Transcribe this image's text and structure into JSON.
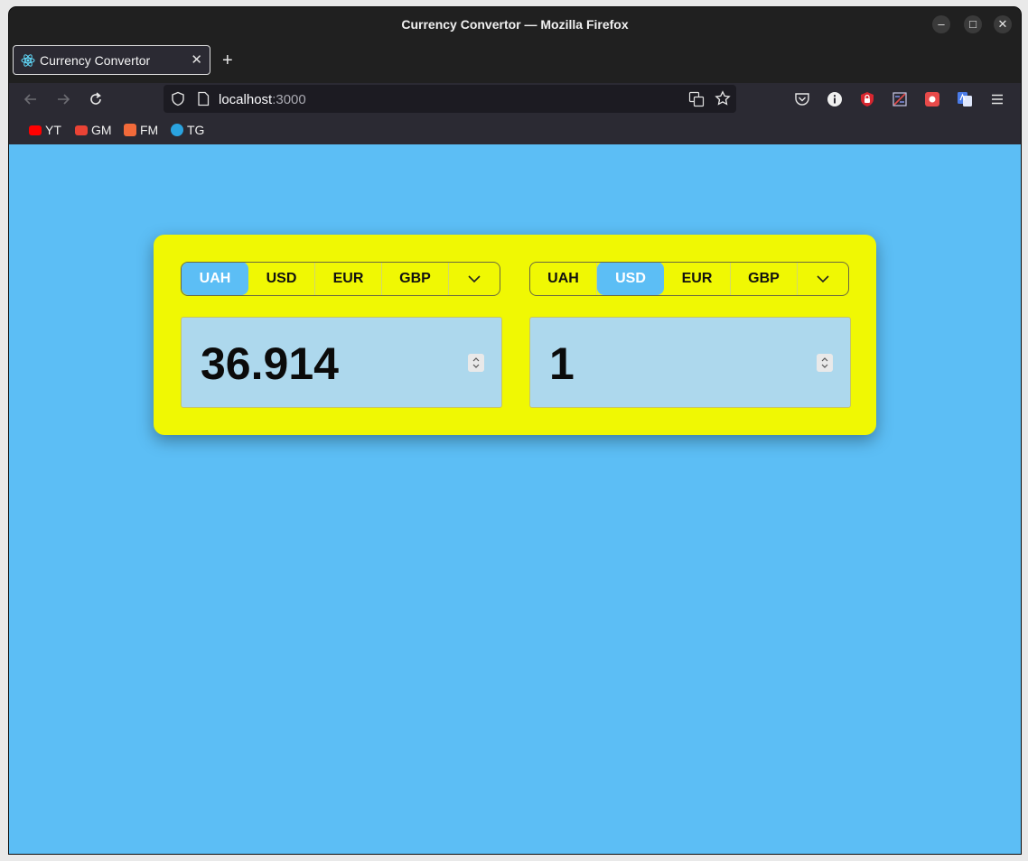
{
  "window": {
    "title": "Currency Convertor — Mozilla Firefox",
    "controls": {
      "minimize": "–",
      "maximize": "□",
      "close": "✕"
    }
  },
  "tab": {
    "title": "Currency Convertor",
    "close": "✕",
    "icon": "react-icon"
  },
  "new_tab": "+",
  "urlbar": {
    "host": "localhost",
    "port": ":3000"
  },
  "bookmarks": [
    {
      "label": "YT",
      "icon": "youtube-icon",
      "color": "#ff0000"
    },
    {
      "label": "GM",
      "icon": "gmail-icon",
      "color": "#ea4335"
    },
    {
      "label": "FM",
      "icon": "fm-icon",
      "color": "#f26a3a"
    },
    {
      "label": "TG",
      "icon": "telegram-icon",
      "color": "#2aa3e0"
    }
  ],
  "colors": {
    "page_bg": "#5cbef5",
    "card_bg": "#f0f803",
    "active_tab": "#5cbef5",
    "input_bg": "#add8ed"
  },
  "converter": {
    "left": {
      "currencies": [
        "UAH",
        "USD",
        "EUR",
        "GBP"
      ],
      "selected": "UAH",
      "amount": "36.914"
    },
    "right": {
      "currencies": [
        "UAH",
        "USD",
        "EUR",
        "GBP"
      ],
      "selected": "USD",
      "amount": "1"
    }
  }
}
